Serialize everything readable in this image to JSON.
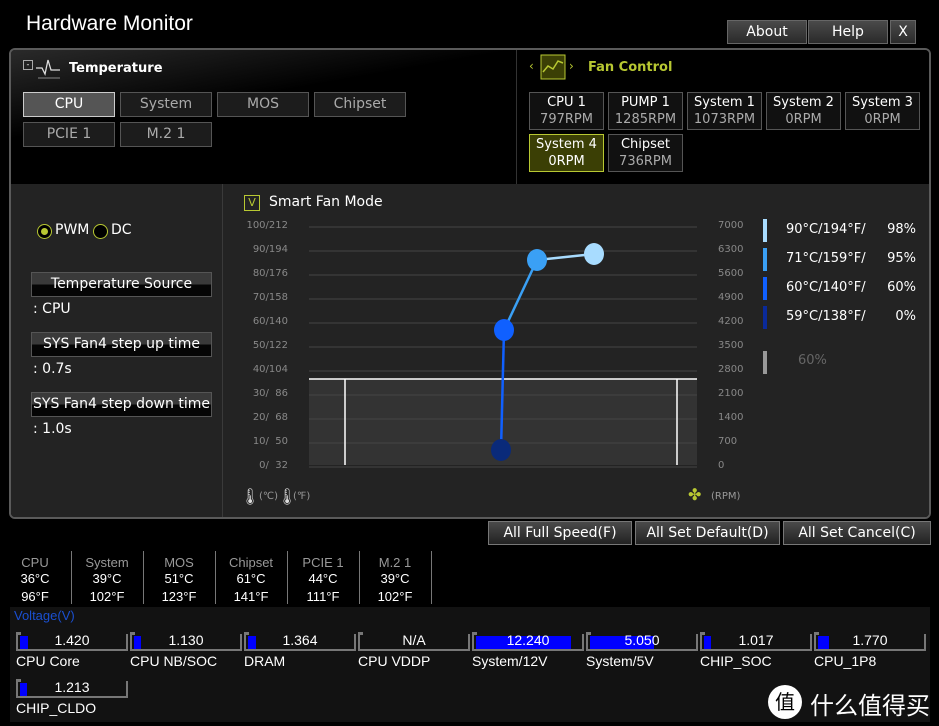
{
  "window": {
    "title": "Hardware Monitor",
    "buttons": [
      "About",
      "Help",
      "X"
    ]
  },
  "temperature": {
    "header": "Temperature",
    "sources": [
      {
        "label": "CPU",
        "selected": true
      },
      {
        "label": "System"
      },
      {
        "label": "MOS"
      },
      {
        "label": "Chipset"
      },
      {
        "label": "PCIE 1"
      },
      {
        "label": "M.2 1"
      }
    ]
  },
  "fan_control": {
    "header": "Fan Control",
    "fans": [
      {
        "name": "CPU 1",
        "rpm": "797RPM"
      },
      {
        "name": "PUMP 1",
        "rpm": "1285RPM"
      },
      {
        "name": "System 1",
        "rpm": "1073RPM"
      },
      {
        "name": "System 2",
        "rpm": "0RPM"
      },
      {
        "name": "System 3",
        "rpm": "0RPM"
      },
      {
        "name": "System 4",
        "rpm": "0RPM",
        "selected": true
      },
      {
        "name": "Chipset",
        "rpm": "736RPM"
      }
    ]
  },
  "settings": {
    "pwm": "PWM",
    "dc": "DC",
    "mode_selected": "PWM",
    "temp_source_label": "Temperature Source",
    "temp_source_value": ": CPU",
    "step_up_label": "SYS Fan4 step up time",
    "step_up_value": ": 0.7s",
    "step_down_label": "SYS Fan4 step down time",
    "step_down_value": ": 1.0s"
  },
  "smart_fan": {
    "label": "Smart Fan Mode",
    "checked": true,
    "check_glyph": "V"
  },
  "chart_data": {
    "type": "line",
    "left_ticks": [
      "100/212",
      "90/194",
      "80/176",
      "70/158",
      "60/140",
      "50/122",
      "40/104",
      "30/  86",
      "20/  68",
      "10/  50",
      "0/  32"
    ],
    "right_ticks": [
      "7000",
      "6300",
      "5600",
      "4900",
      "4200",
      "3500",
      "2800",
      "2100",
      "1400",
      "700",
      "0"
    ],
    "left_unit_c": "(℃)",
    "left_unit_f": "(℉)",
    "right_unit": "(RPM)",
    "points": [
      {
        "temp_c": 59,
        "percent": 0,
        "color": "#0a2a7a"
      },
      {
        "temp_c": 60,
        "percent": 60,
        "color": "#1060ff"
      },
      {
        "temp_c": 71,
        "percent": 95,
        "color": "#3aa0f5"
      },
      {
        "temp_c": 90,
        "percent": 98,
        "color": "#a8dcff"
      }
    ],
    "legend": [
      {
        "temp": "90°C/194°F/",
        "percent": "98%",
        "color": "#a8dcff"
      },
      {
        "temp": "71°C/159°F/",
        "percent": "95%",
        "color": "#3aa0f5"
      },
      {
        "temp": "60°C/140°F/",
        "percent": "60%",
        "color": "#1060ff"
      },
      {
        "temp": "59°C/138°F/",
        "percent": "0%",
        "color": "#0a2a9a"
      }
    ],
    "current_percent": "60%"
  },
  "actions": [
    "All Full Speed(F)",
    "All Set Default(D)",
    "All Set Cancel(C)"
  ],
  "temps": [
    {
      "name": "CPU",
      "c": "36°C",
      "f": "96°F"
    },
    {
      "name": "System",
      "c": "39°C",
      "f": "102°F"
    },
    {
      "name": "MOS",
      "c": "51°C",
      "f": "123°F"
    },
    {
      "name": "Chipset",
      "c": "61°C",
      "f": "141°F"
    },
    {
      "name": "PCIE 1",
      "c": "44°C",
      "f": "111°F"
    },
    {
      "name": "M.2 1",
      "c": "39°C",
      "f": "102°F"
    }
  ],
  "voltage": {
    "header": "Voltage(V)",
    "items": [
      {
        "label": "CPU Core",
        "value": "1.420",
        "fill": 0.08
      },
      {
        "label": "CPU NB/SOC",
        "value": "1.130",
        "fill": 0.06
      },
      {
        "label": "DRAM",
        "value": "1.364",
        "fill": 0.08
      },
      {
        "label": "CPU VDDP",
        "value": "N/A",
        "fill": 0
      },
      {
        "label": "System/12V",
        "value": "12.240",
        "fill": 0.9
      },
      {
        "label": "System/5V",
        "value": "5.050",
        "fill": 0.6
      },
      {
        "label": "CHIP_SOC",
        "value": "1.017",
        "fill": 0.05
      },
      {
        "label": "CPU_1P8",
        "value": "1.770",
        "fill": 0.1
      },
      {
        "label": "CHIP_CLDO",
        "value": "1.213",
        "fill": 0.07
      }
    ]
  },
  "watermark": "什么值得买",
  "colors": {
    "accent": "#b8c832",
    "voltage_bar": "#0000ff",
    "voltage_header": "#1a4fd0"
  }
}
